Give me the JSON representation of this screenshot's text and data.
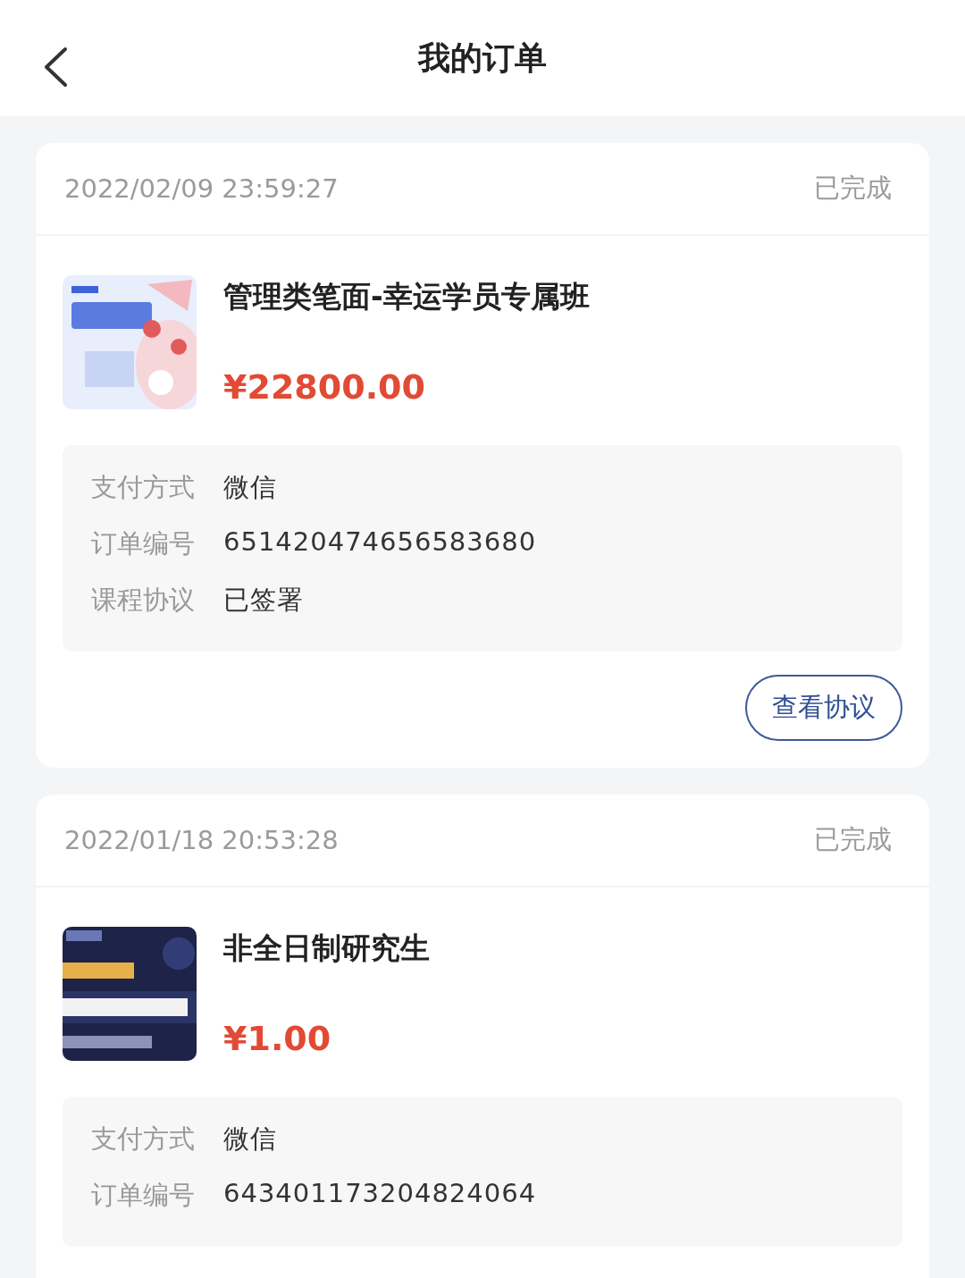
{
  "header": {
    "title": "我的订单"
  },
  "orders": [
    {
      "time": "2022/02/09 23:59:27",
      "status": "已完成",
      "thumbnail": {
        "kind": "picture"
      },
      "title": "管理类笔面-幸运学员专属班",
      "price": "¥22800.00",
      "details": [
        {
          "label": "支付方式",
          "value": "微信"
        },
        {
          "label": "订单编号",
          "value": "651420474656583680"
        },
        {
          "label": "课程协议",
          "value": "已签署"
        }
      ],
      "actions": [
        "查看协议"
      ]
    },
    {
      "time": "2022/01/18 20:53:28",
      "status": "已完成",
      "thumbnail": {
        "kind": "picture"
      },
      "title": "非全日制研究生",
      "price": "¥1.00",
      "details": [
        {
          "label": "支付方式",
          "value": "微信"
        },
        {
          "label": "订单编号",
          "value": "643401173204824064"
        }
      ]
    }
  ]
}
